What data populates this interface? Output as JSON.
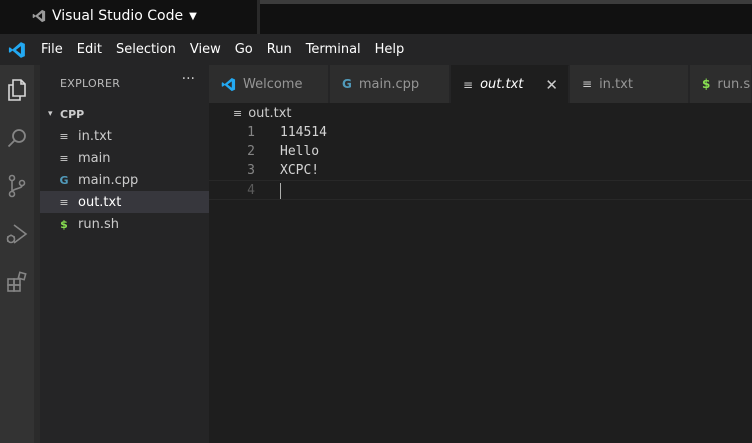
{
  "window": {
    "app_title": "Visual Studio Code",
    "title_caret": "▼"
  },
  "menubar": {
    "items": [
      "File",
      "Edit",
      "Selection",
      "View",
      "Go",
      "Run",
      "Terminal",
      "Help"
    ]
  },
  "activity_bar": {
    "icons": [
      "explorer-icon",
      "search-icon",
      "source-control-icon",
      "run-debug-icon",
      "extensions-icon"
    ]
  },
  "sidebar": {
    "title": "EXPLORER",
    "more": "···",
    "folder": {
      "chevron": "▾",
      "name": "CPP"
    },
    "files": [
      {
        "name": "in.txt",
        "icon": "≡",
        "icon_color": "#cccccc",
        "active": false
      },
      {
        "name": "main",
        "icon": "≡",
        "icon_color": "#cccccc",
        "active": false
      },
      {
        "name": "main.cpp",
        "icon": "G",
        "icon_color": "#519aba",
        "active": false
      },
      {
        "name": "out.txt",
        "icon": "≡",
        "icon_color": "#cccccc",
        "active": true
      },
      {
        "name": "run.sh",
        "icon": "$",
        "icon_color": "#89e051",
        "active": false
      }
    ]
  },
  "tabs": [
    {
      "label": "Welcome",
      "icon": "welcome-icon",
      "active": false
    },
    {
      "label": "main.cpp",
      "icon": "G",
      "icon_color": "#519aba",
      "active": false
    },
    {
      "label": "out.txt",
      "icon": "≡",
      "icon_color": "#cccccc",
      "active": true,
      "close": "✕"
    },
    {
      "label": "in.txt",
      "icon": "≡",
      "icon_color": "#cccccc",
      "active": false
    },
    {
      "label": "run.sh",
      "icon": "$",
      "icon_color": "#89e051",
      "active": false
    }
  ],
  "editor": {
    "breadcrumb": {
      "icon": "≡",
      "file": "out.txt"
    },
    "lines": [
      {
        "num": "1",
        "text": "114514"
      },
      {
        "num": "2",
        "text": "Hello"
      },
      {
        "num": "3",
        "text": "XCPC!"
      },
      {
        "num": "4",
        "text": ""
      }
    ]
  },
  "colors": {
    "accent": "#007acc",
    "cpp": "#519aba",
    "shell": "#89e051"
  }
}
